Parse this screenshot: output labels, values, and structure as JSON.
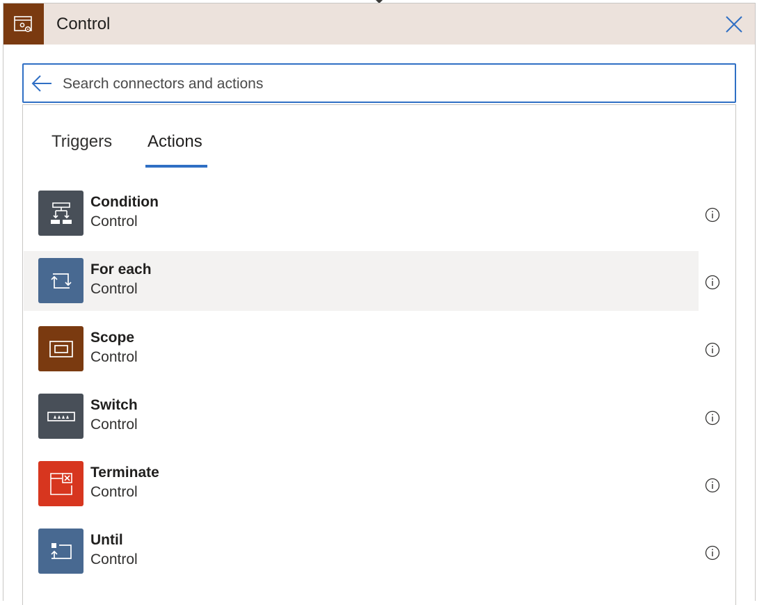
{
  "header": {
    "title": "Control",
    "icon": "control-gear-icon",
    "icon_bg": "#7a3a10",
    "bg": "#ece2dc",
    "close_icon": "close-icon"
  },
  "search": {
    "placeholder": "Search connectors and actions",
    "value": "",
    "back_icon": "back-arrow-icon",
    "border_color": "#2f6fc4"
  },
  "tabs": [
    {
      "label": "Triggers",
      "active": false
    },
    {
      "label": "Actions",
      "active": true
    }
  ],
  "actions": [
    {
      "name": "Condition",
      "connector": "Control",
      "icon": "condition-icon",
      "color": "#484f58"
    },
    {
      "name": "For each",
      "connector": "Control",
      "icon": "loop-icon",
      "color": "#486991"
    },
    {
      "name": "Scope",
      "connector": "Control",
      "icon": "scope-icon",
      "color": "#7a3a10"
    },
    {
      "name": "Switch",
      "connector": "Control",
      "icon": "switch-icon",
      "color": "#484f58"
    },
    {
      "name": "Terminate",
      "connector": "Control",
      "icon": "terminate-icon",
      "color": "#d7361f"
    },
    {
      "name": "Until",
      "connector": "Control",
      "icon": "until-icon",
      "color": "#486991"
    }
  ]
}
